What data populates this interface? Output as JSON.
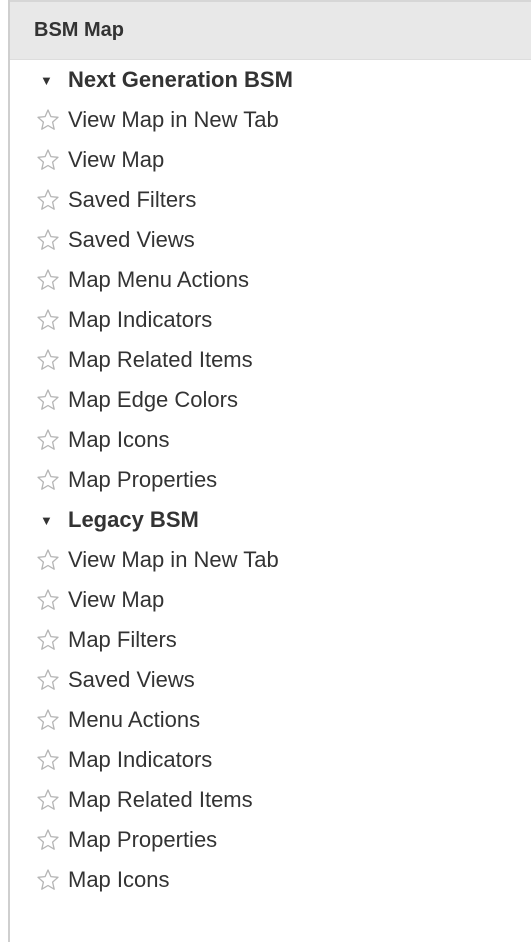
{
  "panel": {
    "title": "BSM Map"
  },
  "sections": [
    {
      "label": "Next Generation BSM",
      "expanded": true,
      "items": [
        {
          "label": "View Map in New Tab",
          "icon": "star-outline-icon"
        },
        {
          "label": "View Map",
          "icon": "star-outline-icon"
        },
        {
          "label": "Saved Filters",
          "icon": "star-outline-icon"
        },
        {
          "label": "Saved Views",
          "icon": "star-outline-icon"
        },
        {
          "label": "Map Menu Actions",
          "icon": "star-outline-icon"
        },
        {
          "label": "Map Indicators",
          "icon": "star-outline-icon"
        },
        {
          "label": "Map Related Items",
          "icon": "star-outline-icon"
        },
        {
          "label": "Map Edge Colors",
          "icon": "star-outline-icon"
        },
        {
          "label": "Map Icons",
          "icon": "star-outline-icon"
        },
        {
          "label": "Map Properties",
          "icon": "star-outline-icon"
        }
      ]
    },
    {
      "label": "Legacy BSM",
      "expanded": true,
      "items": [
        {
          "label": "View Map in New Tab",
          "icon": "star-outline-icon"
        },
        {
          "label": "View Map",
          "icon": "star-outline-icon"
        },
        {
          "label": "Map Filters",
          "icon": "star-outline-icon"
        },
        {
          "label": "Saved Views",
          "icon": "star-outline-icon"
        },
        {
          "label": "Menu Actions",
          "icon": "star-outline-icon"
        },
        {
          "label": "Map Indicators",
          "icon": "star-outline-icon"
        },
        {
          "label": "Map Related Items",
          "icon": "star-outline-icon"
        },
        {
          "label": "Map Properties",
          "icon": "star-outline-icon"
        },
        {
          "label": "Map Icons",
          "icon": "star-outline-icon"
        }
      ]
    }
  ],
  "colors": {
    "header_bg": "#e8e8e8",
    "text": "#333333",
    "star_stroke": "#b5b5b5",
    "panel_border": "#cfcfcf"
  }
}
